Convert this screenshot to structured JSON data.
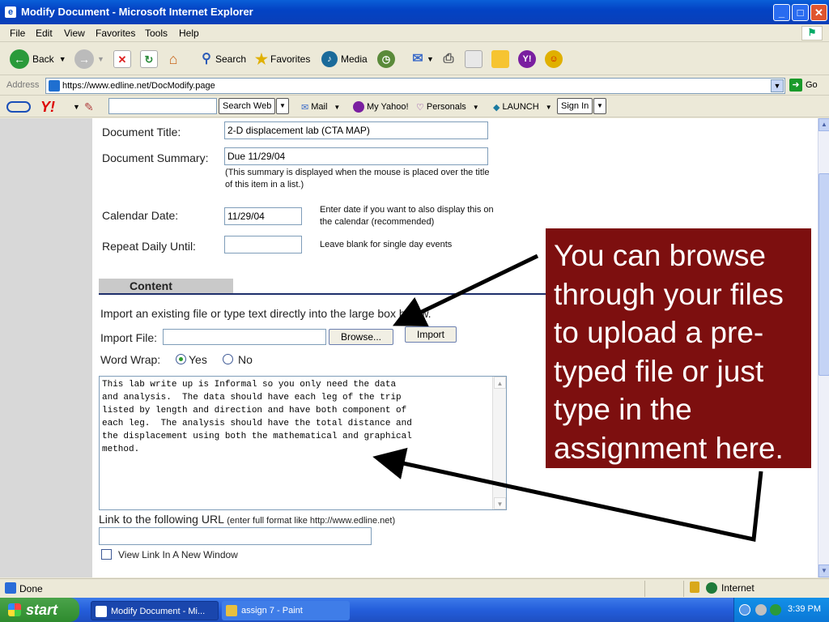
{
  "window": {
    "title": "Modify Document - Microsoft Internet Explorer"
  },
  "menu": [
    "File",
    "Edit",
    "View",
    "Favorites",
    "Tools",
    "Help"
  ],
  "toolbar": {
    "back": "Back",
    "search": "Search",
    "favorites": "Favorites",
    "media": "Media"
  },
  "address": {
    "label": "Address",
    "url": "https://www.edline.net/DocModify.page",
    "go": "Go"
  },
  "yahoo": {
    "search_web": "Search Web",
    "mail": "Mail",
    "my_yahoo": "My Yahoo!",
    "personals": "Personals",
    "launch": "LAUNCH",
    "sign_in": "Sign In"
  },
  "form": {
    "doc_title_label": "Document Title:",
    "doc_title_value": "2-D displacement lab (CTA MAP)",
    "summary_label": "Document Summary:",
    "summary_value": "Due 11/29/04",
    "summary_note": "(This summary is displayed when the mouse is placed over the title of this item in a list.)",
    "calendar_label": "Calendar Date:",
    "calendar_value": "11/29/04",
    "calendar_note": "Enter date if you want to also display this on the calendar (recommended)",
    "repeat_label": "Repeat Daily Until:",
    "repeat_note": "Leave blank for single day events",
    "content_header": "Content",
    "import_instruction": "Import an existing file or type text directly into the large box below.",
    "import_file_label": "Import File:",
    "browse_button": "Browse...",
    "import_button": "Import",
    "word_wrap_label": "Word Wrap:",
    "wrap_yes": "Yes",
    "wrap_no": "No",
    "body_text": "This lab write up is Informal so you only need the data\nand analysis.  The data should have each leg of the trip\nlisted by length and direction and have both component of\neach leg.  The analysis should have the total distance and\nthe displacement using both the mathematical and graphical\nmethod.",
    "link_label": "Link to the following URL",
    "link_hint": "(enter full format like http://www.edline.net)",
    "new_window_label": "View Link In A New Window"
  },
  "callout": {
    "text": "You can browse through your files to upload a pre-typed file or just type in the assignment here."
  },
  "status": {
    "text": "Done",
    "zone": "Internet"
  },
  "taskbar": {
    "start": "start",
    "task1": "Modify Document - Mi...",
    "task2": "assign 7 - Paint",
    "clock": "3:39 PM"
  }
}
